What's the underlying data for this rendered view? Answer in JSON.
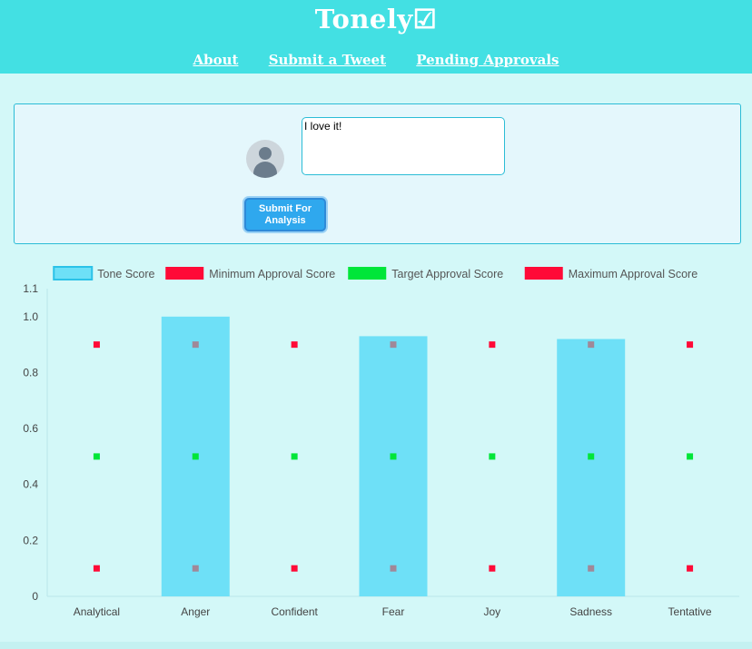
{
  "app": {
    "title": "Tonely☑"
  },
  "nav": {
    "items": [
      "About",
      "Submit a Tweet",
      "Pending Approvals"
    ]
  },
  "composer": {
    "tweet_text": "I love it!",
    "submit_label": "Submit For Analysis"
  },
  "colors": {
    "header": "#43e0e3",
    "tone_bar": "#6ee0f7",
    "min_approval": "#ff0a37",
    "target_approval": "#00e639",
    "max_approval": "#ff0a37"
  },
  "chart_data": {
    "type": "bar",
    "categories": [
      "Analytical",
      "Anger",
      "Confident",
      "Fear",
      "Joy",
      "Sadness",
      "Tentative"
    ],
    "series": [
      {
        "name": "Tone Score",
        "type": "bar",
        "values": [
          0,
          1.0,
          0,
          0.93,
          0,
          0.92,
          0
        ]
      },
      {
        "name": "Minimum Approval Score",
        "type": "point",
        "values": [
          0.1,
          0.1,
          0.1,
          0.1,
          0.1,
          0.1,
          0.1
        ]
      },
      {
        "name": "Target Approval Score",
        "type": "point",
        "values": [
          0.5,
          0.5,
          0.5,
          0.5,
          0.5,
          0.5,
          0.5
        ]
      },
      {
        "name": "Maximum Approval Score",
        "type": "point",
        "values": [
          0.9,
          0.9,
          0.9,
          0.9,
          0.9,
          0.9,
          0.9
        ]
      }
    ],
    "y_ticks": [
      "1.1",
      "1.0",
      "0.8",
      "0.6",
      "0.4",
      "0.2",
      "0"
    ],
    "ylim": [
      0,
      1.1
    ],
    "legend_position": "top"
  }
}
